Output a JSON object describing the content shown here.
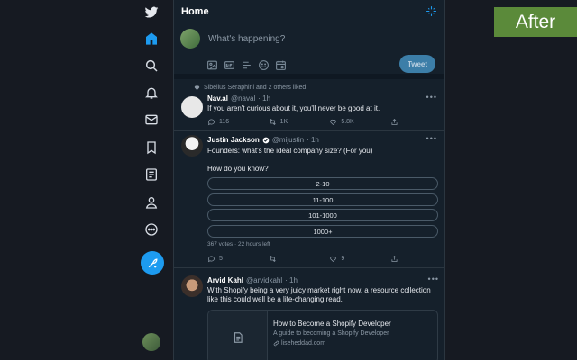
{
  "badge": {
    "label": "After"
  },
  "header": {
    "title": "Home"
  },
  "composer": {
    "placeholder": "What's happening?",
    "tweet_label": "Tweet"
  },
  "tweets": [
    {
      "liked_by": "Sibelius Seraphini and 2 others liked",
      "name": "Nav.al",
      "handle": "@naval",
      "time": "· 1h",
      "text": "If you aren't curious about it, you'll never be good at it.",
      "replies": "116",
      "retweets": "1K",
      "likes": "5.8K"
    },
    {
      "name": "Justin Jackson",
      "handle": "@mijustin",
      "time": "· 1h",
      "text_line1": "Founders: what's the ideal company size? (For you)",
      "text_line2": "How do you know?",
      "poll_options": [
        "2-10",
        "11-100",
        "101-1000",
        "1000+"
      ],
      "poll_meta": "367 votes · 22 hours left",
      "replies": "5",
      "likes": "9"
    },
    {
      "name": "Arvid Kahl",
      "handle": "@arvidkahl",
      "time": "· 1h",
      "text_line1": "With Shopify being a very juicy market right now,  a resource collection",
      "text_line2": "like this could well be a life-changing read.",
      "card_title": "How to Become a Shopify Developer",
      "card_desc": "A guide to becoming a Shopify Developer",
      "card_url": "liseheddad.com"
    }
  ]
}
